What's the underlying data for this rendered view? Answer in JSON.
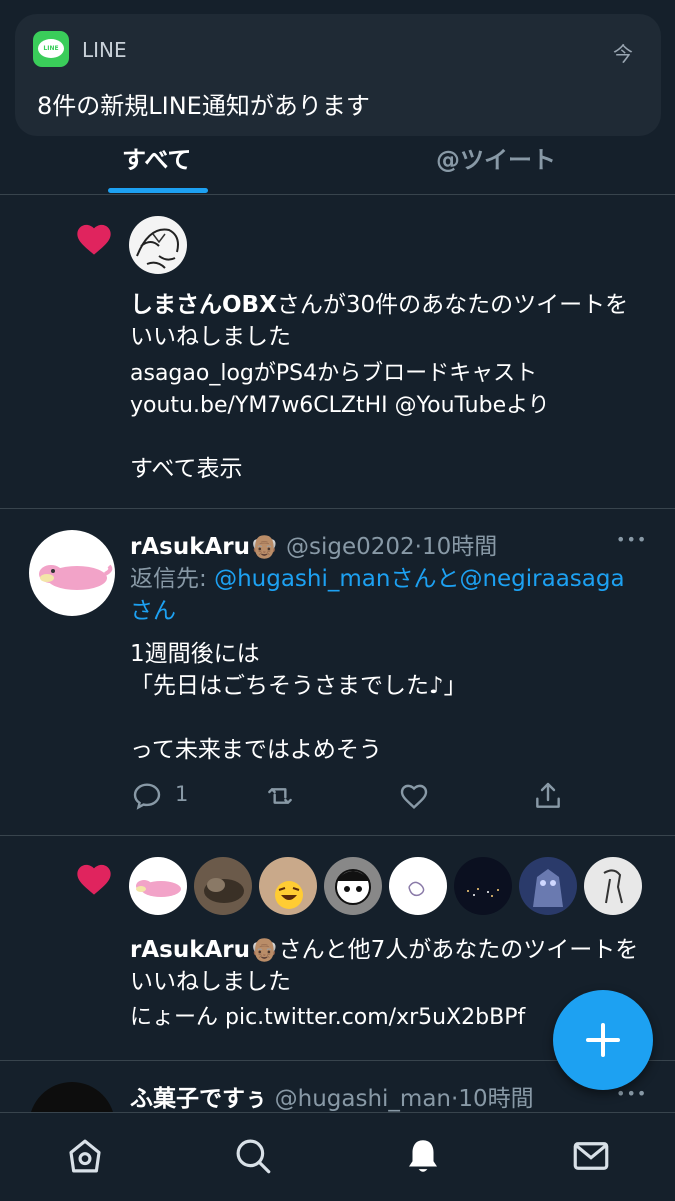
{
  "notification": {
    "app_name": "LINE",
    "logo_text": "LINE",
    "time": "今",
    "message": "8件の新規LINE通知があります"
  },
  "tabs": [
    {
      "label": "すべて",
      "active": true
    },
    {
      "label": "@ツイート",
      "active": false
    }
  ],
  "items": [
    {
      "type": "like",
      "bold_name": "しまさんOBX",
      "text_rest": "さんが30件のあなたのツイートを",
      "text_line2": "いいねしました",
      "preview_line1": "asagao_logがPS4からブロードキャスト",
      "preview_line2": "youtu.be/YM7w6CLZtHI @YouTubeより",
      "show_all": "すべて表示"
    },
    {
      "type": "tweet",
      "name": "rAsukAru👴🏽",
      "handle": "@sige0202",
      "dot": "·",
      "time": "10時間",
      "more": "•••",
      "reply_label": "返信先: ",
      "reply_user1": "@hugashi_man",
      "reply_and": "さんと",
      "reply_user2": "@negiraasaga",
      "reply_suffix": "さん",
      "lines": [
        "1週間後には",
        "「先日はごちそうさまでした♪」",
        "",
        "って未来まではよめそう"
      ],
      "reply_count": "1"
    },
    {
      "type": "like",
      "bold_name": "rAsukAru👴🏽",
      "text_rest": "さんと他7人があなたのツイートを",
      "text_line2": "いいねしました",
      "preview_line1": "にょーん pic.twitter.com/xr5uX2bBPf"
    },
    {
      "type": "tweet",
      "name": "ふ菓子ですぅ",
      "handle": "@hugashi_man",
      "dot": "·",
      "time": "10時間",
      "more": "•••"
    }
  ],
  "colors": {
    "background": "#15202b",
    "accent": "#1da1f2",
    "like": "#e0245e",
    "muted": "#8899a6"
  },
  "icons": [
    "heart-icon",
    "reply-icon",
    "retweet-icon",
    "like-icon",
    "share-icon",
    "compose-icon",
    "home-icon",
    "search-icon",
    "notifications-icon",
    "messages-icon"
  ]
}
